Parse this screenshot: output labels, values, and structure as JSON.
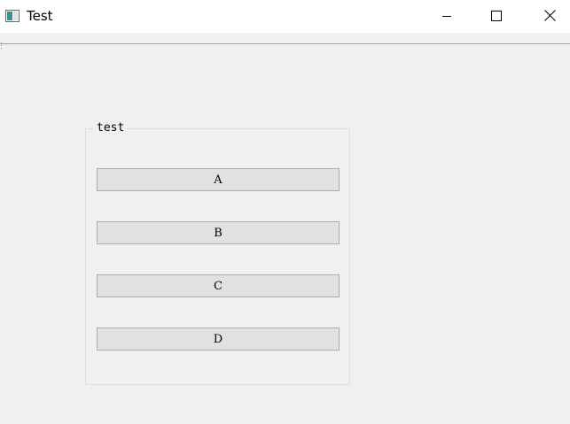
{
  "window": {
    "title": "Test",
    "icon": "app-window-icon",
    "controls": {
      "minimize_icon": "minimize-icon",
      "maximize_icon": "maximize-icon",
      "close_icon": "close-icon"
    }
  },
  "groupbox": {
    "title": "test",
    "buttons": [
      {
        "label": "A"
      },
      {
        "label": "B"
      },
      {
        "label": "C"
      },
      {
        "label": "D"
      }
    ]
  },
  "colors": {
    "titlebar_bg": "#ffffff",
    "client_bg": "#f0f0f0",
    "button_bg": "#e1e1e1",
    "button_border": "#adadad",
    "groupbox_border": "#dcdcdc"
  }
}
